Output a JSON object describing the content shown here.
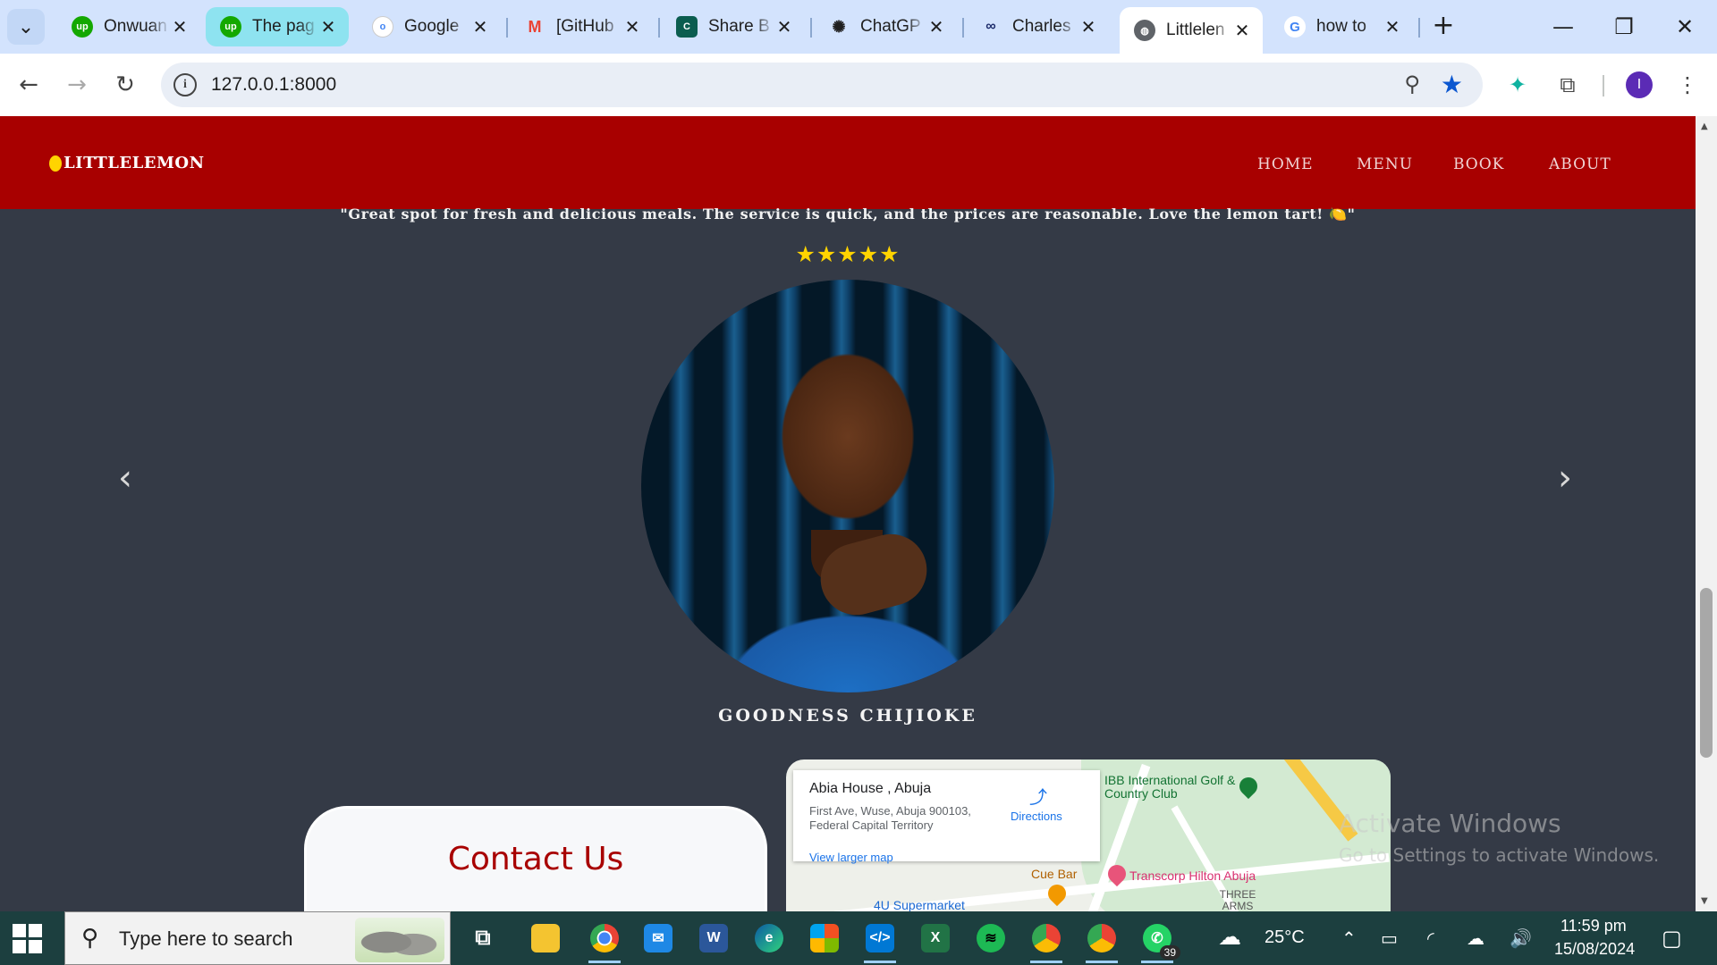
{
  "browser": {
    "tabs": [
      {
        "title": "Onwuan",
        "favicon": "upwork-icon",
        "color": "#14a800"
      },
      {
        "title": "The pag",
        "favicon": "upwork-icon",
        "color": "#14a800"
      },
      {
        "title": "Google",
        "favicon": "google-password-icon",
        "color": "#4285f4"
      },
      {
        "title": "[GitHub",
        "favicon": "gmail-icon",
        "color": "#ea4335"
      },
      {
        "title": "Share B",
        "favicon": "coursera-icon",
        "color": "#0b5d4f"
      },
      {
        "title": "ChatGP",
        "favicon": "chatgpt-icon",
        "color": "#1f1f1f"
      },
      {
        "title": "Charles",
        "favicon": "meta-icon",
        "color": "#1c2b6b"
      },
      {
        "title": "Littlelen",
        "favicon": "globe-icon",
        "color": "#5f6368"
      },
      {
        "title": "how to",
        "favicon": "google-icon",
        "color": "#4285f4"
      }
    ],
    "active_tab_index": 7,
    "url": "127.0.0.1:8000",
    "profile_initial": "I"
  },
  "site": {
    "logo": "LITTLELEMON",
    "nav": [
      "HOME",
      "MENU",
      "BOOK",
      "ABOUT"
    ],
    "testimonial": {
      "quote": "\"Great spot for fresh and delicious meals. The service is quick, and the prices are reasonable. Love the lemon tart! 🍋\"",
      "stars": "★★★★★",
      "rating": 5,
      "name": "GOODNESS CHIJIOKE"
    },
    "contact_title": "Contact Us",
    "map": {
      "place": "Abia House , Abuja",
      "address": "First Ave, Wuse, Abuja 900103, Federal Capital Territory",
      "directions": "Directions",
      "view_larger": "View larger map",
      "labels": [
        "IBB International Golf & Country Club",
        "Cue Bar",
        "Transcorp Hilton Abuja",
        "4U Supermarket",
        "THREE ARMS ZONE"
      ]
    }
  },
  "watermark": {
    "line1": "Activate Windows",
    "line2": "Go to Settings to activate Windows."
  },
  "taskbar": {
    "search_placeholder": "Type here to search",
    "weather": "25°C",
    "time": "11:59 pm",
    "date": "15/08/2024",
    "whatsapp_badge": "39"
  }
}
